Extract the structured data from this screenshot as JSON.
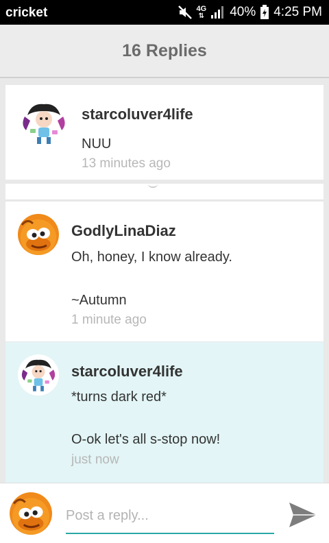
{
  "status_bar": {
    "carrier": "cricket",
    "network": "4G",
    "battery": "40%",
    "time": "4:25 PM"
  },
  "header": {
    "title": "16 Replies"
  },
  "replies": [
    {
      "username": "starcoluver4life",
      "text": "NUU",
      "time": "13 minutes ago",
      "avatar": "cartoon-girl-avatar"
    },
    {
      "username": "GodlyLinaDiaz",
      "text_line1": "Oh, honey, I know already.",
      "text_line2": "~Autumn",
      "time": "1 minute ago",
      "avatar": "orange-monster-avatar"
    },
    {
      "username": "starcoluver4life",
      "text_line1": "*turns dark red*",
      "text_line2": "O-ok let's all s-stop now!",
      "time": "just now",
      "avatar": "cartoon-girl-avatar",
      "highlighted": true
    }
  ],
  "reply_bar": {
    "placeholder": "Post a reply...",
    "avatar": "orange-monster-avatar"
  },
  "colors": {
    "accent": "#2aa7a8",
    "highlight_bg": "#e3f5f6",
    "header_bg": "#ececec"
  }
}
